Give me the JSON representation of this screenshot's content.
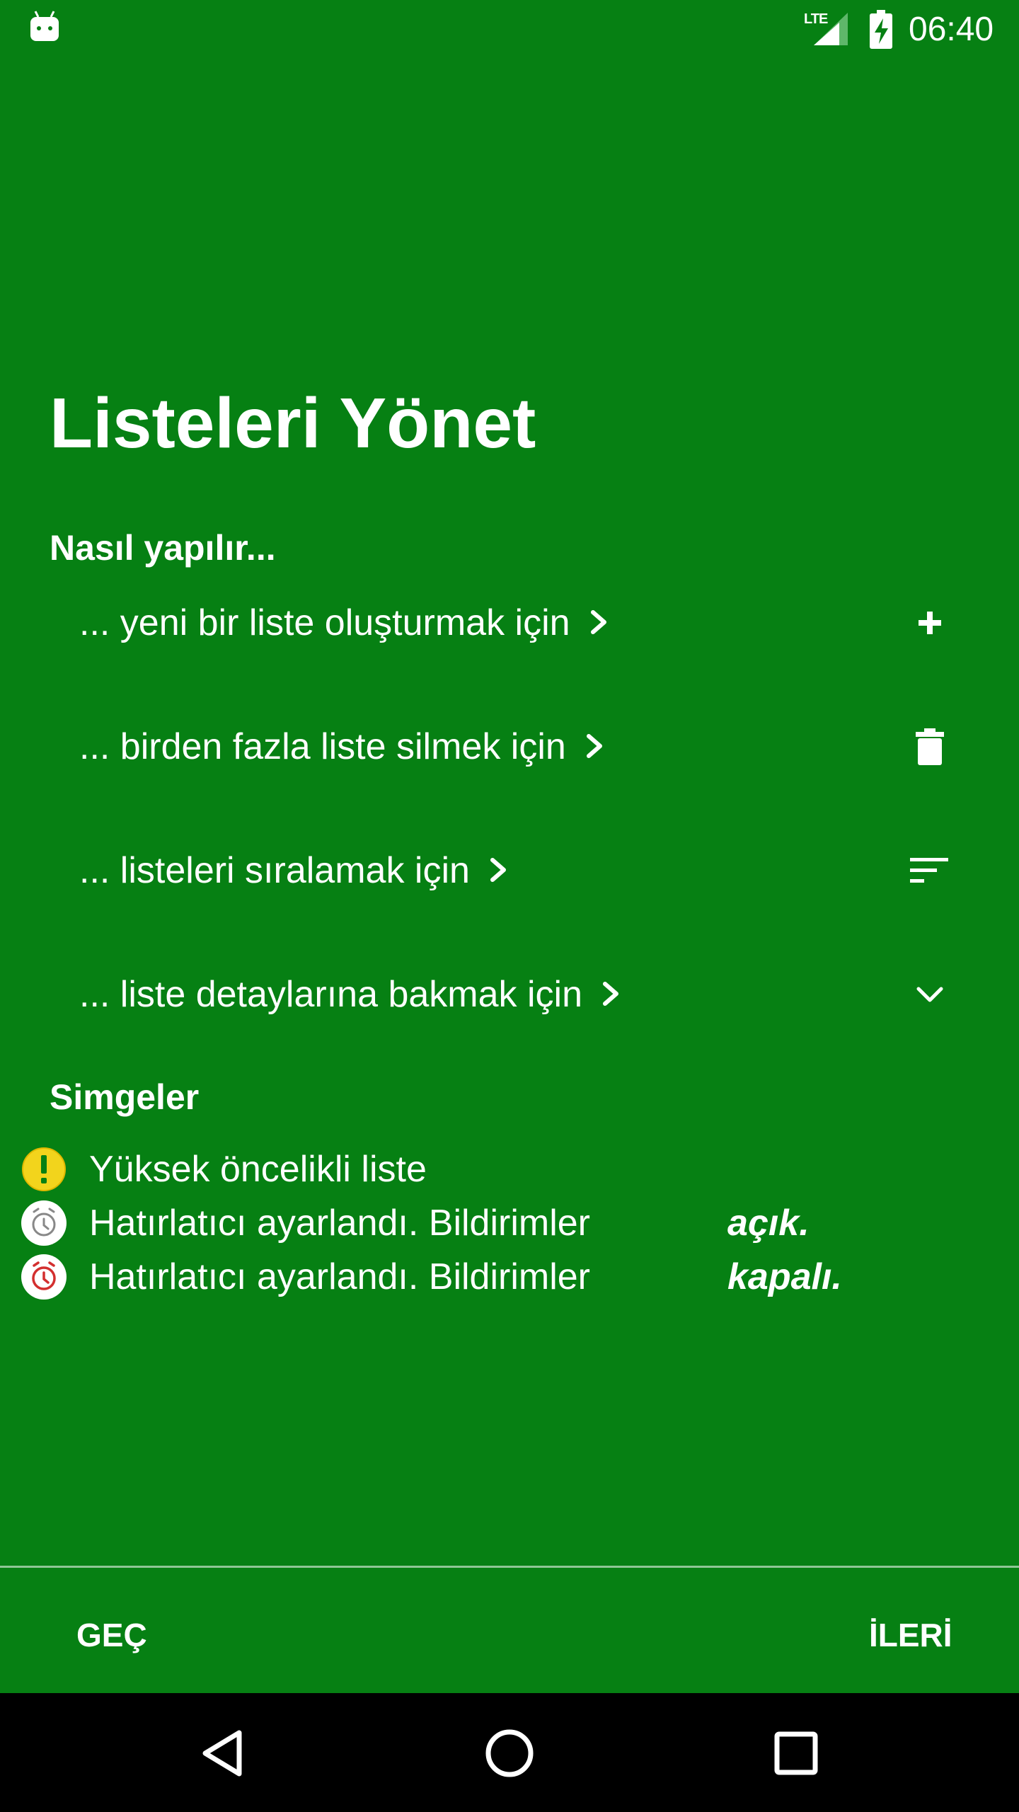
{
  "status_bar": {
    "time": "06:40",
    "network_label": "LTE",
    "icons": [
      "android-debug-icon",
      "lte-signal-icon",
      "battery-charging-icon"
    ]
  },
  "page": {
    "title": "Listeleri Yönet",
    "howto_heading": "Nasıl yapılır...",
    "howto_items": [
      {
        "label": "... yeni bir liste oluşturmak için",
        "icon": "plus-icon"
      },
      {
        "label": "... birden fazla liste silmek için",
        "icon": "trash-icon"
      },
      {
        "label": "... listeleri sıralamak için",
        "icon": "sort-icon"
      },
      {
        "label": "... liste detaylarına bakmak için",
        "icon": "chevron-down-icon"
      }
    ],
    "legend_heading": "Simgeler",
    "legend_items": [
      {
        "text": "Yüksek öncelikli liste",
        "state": "",
        "icon": "priority-exclamation-icon"
      },
      {
        "text": "Hatırlatıcı ayarlandı. Bildirimler",
        "state": "açık.",
        "icon": "alarm-gray-icon"
      },
      {
        "text": "Hatırlatıcı ayarlandı. Bildirimler",
        "state": "kapalı.",
        "icon": "alarm-red-icon"
      }
    ]
  },
  "footer": {
    "skip_label": "GEÇ",
    "next_label": "İLERİ"
  },
  "colors": {
    "background": "#068013",
    "text": "#ffffff",
    "priority_yellow": "#f2d41c",
    "alarm_red": "#d32f2f",
    "nav_bar": "#000000"
  },
  "nav_bar": {
    "icons": [
      "back-triangle-icon",
      "home-circle-icon",
      "recents-square-icon"
    ]
  }
}
